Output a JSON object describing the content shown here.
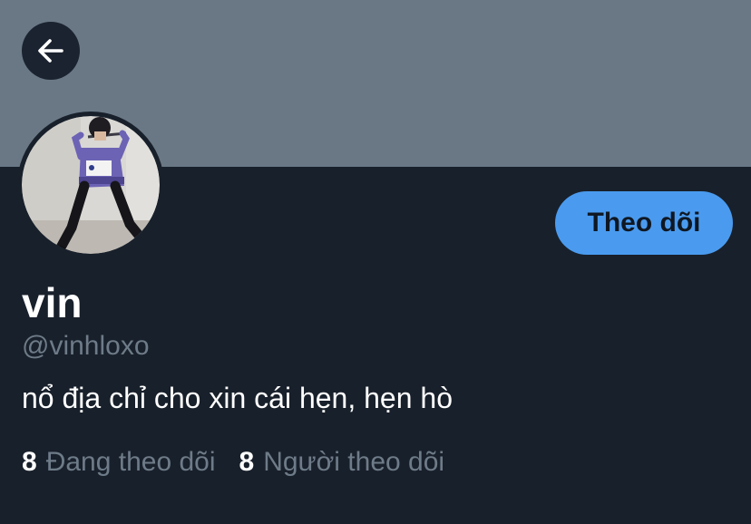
{
  "header": {
    "back_icon": "arrow-left-icon"
  },
  "profile": {
    "display_name": "vin",
    "handle": "@vinhloxo",
    "bio": "nổ địa chỉ cho xin cái hẹn, hẹn hò",
    "follow_button_label": "Theo dõi"
  },
  "stats": {
    "following_count": "8",
    "following_label": "Đang theo dõi",
    "followers_count": "8",
    "followers_label": "Người theo dõi"
  },
  "colors": {
    "banner": "#6a7886",
    "background": "#18202b",
    "accent": "#4a9bef",
    "muted_text": "#6e7b88"
  }
}
